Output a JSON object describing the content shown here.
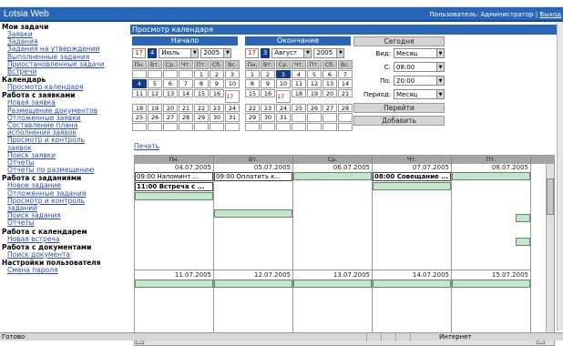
{
  "topbar": {
    "app_title": "Lotsia Web",
    "user_label": "Пользователь: Администратор",
    "separator": "|",
    "logout_label": "Выход"
  },
  "sidebar": [
    {
      "section": "Мои задачи",
      "links": [
        "Заявки",
        "Задания",
        "Задания на утверждении",
        "Выполненные задания",
        "Приостановленные задачи",
        "Встречи"
      ]
    },
    {
      "section": "Календарь",
      "links": [
        "Просмотр календаря"
      ]
    },
    {
      "section": "Работа с заявками",
      "links": [
        "Новая заявка",
        "Размещение документов",
        "Отложенные заявки",
        "Составление плана",
        "исполнения заявок",
        "Просмотр и контроль",
        "заявок",
        "Поиск заявки",
        "Отчеты",
        "Отчеты по размещению"
      ]
    },
    {
      "section": "Работа с заданиями",
      "links": [
        "Новое задание",
        "Отложенные задания",
        "Просмотр и контроль",
        "заданий",
        "Поиск задания",
        "Отчеты"
      ]
    },
    {
      "section": "Работа с календарем",
      "links": [
        "Новая встреча"
      ]
    },
    {
      "section": "Работа с документами",
      "links": [
        "Поиск документа"
      ]
    },
    {
      "section": "Настройки пользователя",
      "links": [
        "Смена пароля"
      ]
    }
  ],
  "page_title": "Просмотр календаря",
  "start_cal": {
    "title": "Начало",
    "day_red": "17",
    "day_blue": "4",
    "month": "Июль",
    "year": "2005",
    "weekdays": [
      "Пн.",
      "Вт.",
      "Ср.",
      "Чт.",
      "Пт.",
      "Сб.",
      "Вс."
    ],
    "days": [
      "",
      "",
      "",
      "",
      "1",
      "2",
      "3",
      "4",
      "5",
      "6",
      "7",
      "8",
      "9",
      "10",
      "11",
      "12",
      "13",
      "14",
      "15",
      "16",
      "17",
      "18",
      "19",
      "20",
      "21",
      "22",
      "23",
      "24",
      "25",
      "26",
      "27",
      "28",
      "29",
      "30",
      "31",
      "",
      "",
      "",
      "",
      "",
      "",
      ""
    ],
    "today_index": 7,
    "selected_index": 20
  },
  "end_cal": {
    "title": "Окончание",
    "day_red": "17",
    "day_blue": "3",
    "month": "Август",
    "year": "2005",
    "weekdays": [
      "Пн.",
      "Вт.",
      "Ср.",
      "Чт.",
      "Пт.",
      "Сб.",
      "Вс."
    ],
    "days": [
      "1",
      "2",
      "3",
      "4",
      "5",
      "6",
      "7",
      "8",
      "9",
      "10",
      "11",
      "12",
      "13",
      "14",
      "15",
      "16",
      "17",
      "18",
      "19",
      "20",
      "21",
      "22",
      "23",
      "24",
      "25",
      "26",
      "27",
      "28",
      "29",
      "30",
      "31",
      "",
      "",
      "",
      "",
      "",
      "",
      "",
      "",
      "",
      "",
      ""
    ],
    "today_index": 2,
    "selected_index": 16
  },
  "controls": {
    "today_button": "Сегодня",
    "view_label": "Вид:",
    "view_value": "Месяц",
    "from_label": "С:",
    "from_value": "08:00",
    "to_label": "По:",
    "to_value": "20:00",
    "period_label": "Период:",
    "period_value": "Месяц",
    "go_button": "Перейти",
    "add_button": "Добавить"
  },
  "print_link": "Печать",
  "week": {
    "headers": [
      "Пн.",
      "Вт.",
      "Ср.",
      "Чт.",
      "Пт."
    ],
    "dates_row1": [
      "04.07.2005",
      "05.07.2005",
      "06.07.2005",
      "07.07.2005",
      "08.07.2005"
    ],
    "dates_row2": [
      "11.07.2005",
      "12.07.2005",
      "13.07.2005",
      "14.07.2005",
      "15.07.2005"
    ],
    "events": {
      "mon_1": "09:00  Напоминт ...",
      "mon_2": "11:00  Встреча с ...",
      "tue_1": "09:00  Оплатить к...",
      "thu_1": "08:00  Совещание ..."
    }
  },
  "status": {
    "left": "Готово",
    "right": "Интернет"
  }
}
